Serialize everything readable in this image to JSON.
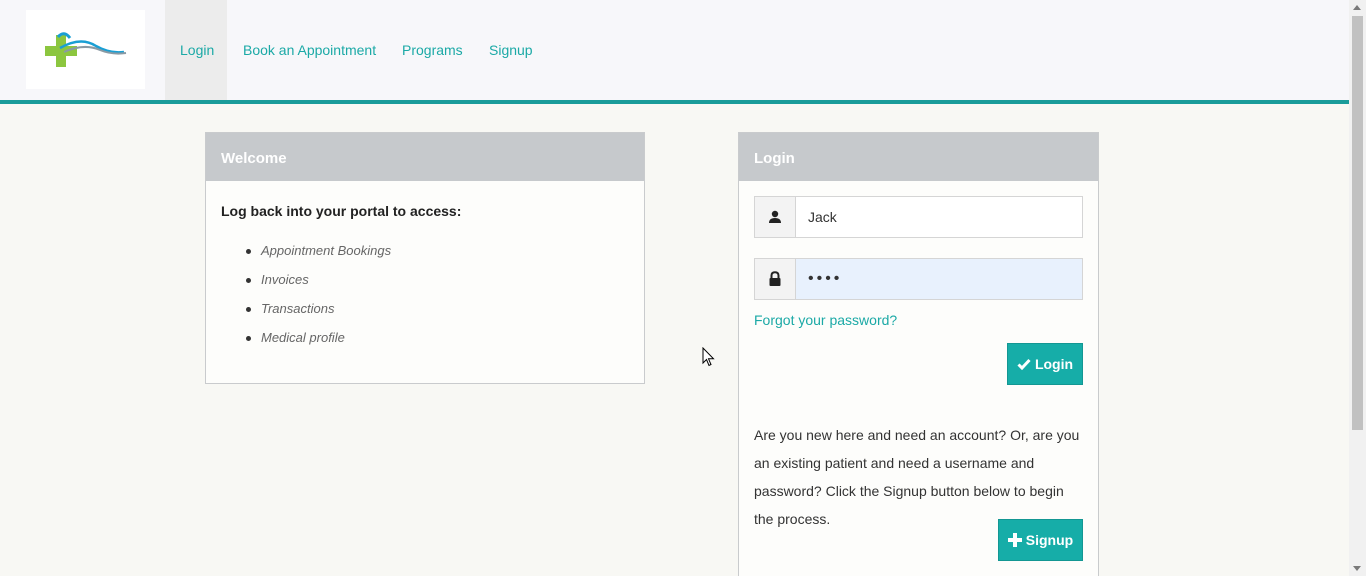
{
  "nav": {
    "items": [
      {
        "label": "Login",
        "active": true
      },
      {
        "label": "Book an Appointment"
      },
      {
        "label": "Programs"
      },
      {
        "label": "Signup"
      }
    ]
  },
  "welcome": {
    "title": "Welcome",
    "lead": "Log back into your portal to access:",
    "items": [
      "Appointment Bookings",
      "Invoices",
      "Transactions",
      "Medical profile"
    ]
  },
  "login": {
    "title": "Login",
    "username": "Jack",
    "password": "••••",
    "forgot": "Forgot your password?",
    "submit": "Login",
    "signup_prompt": "Are you new here and need an account? Or, are you an existing patient and need a username and password? Click the Signup button below to begin the process.",
    "signup_button": "Signup"
  },
  "colors": {
    "accent": "#16ada8",
    "link": "#1ba9a6",
    "panel_header": "#c6c9cc"
  },
  "icons": [
    "logo-icon",
    "user-icon",
    "lock-icon",
    "check-icon",
    "plus-icon",
    "cursor-icon"
  ]
}
